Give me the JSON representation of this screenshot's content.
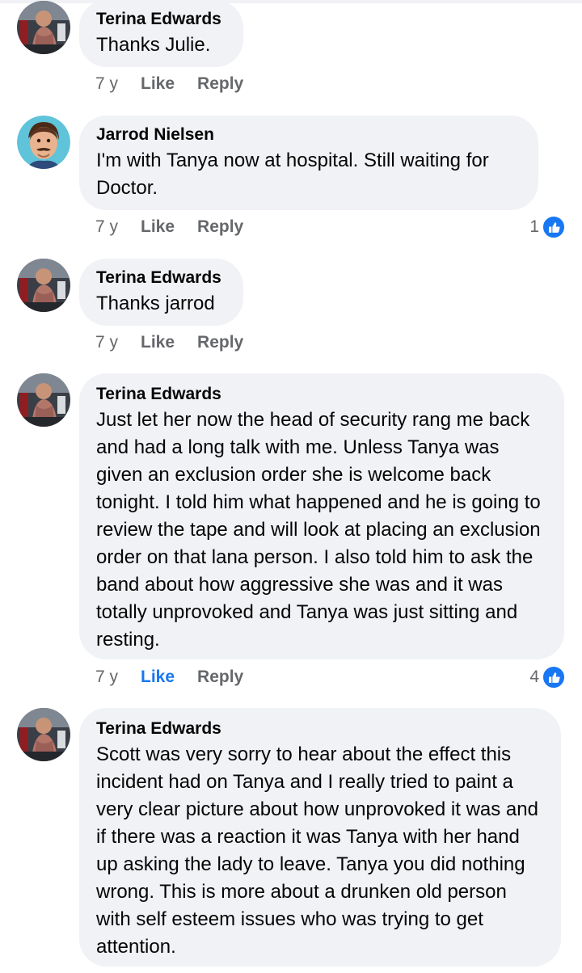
{
  "colors": {
    "bubble": "#f0f2f5",
    "meta_text": "#65676b",
    "like_active": "#1877f2",
    "like_badge": "#1877f2"
  },
  "comments": [
    {
      "author": "Terina Edwards",
      "text": "Thanks Julie.",
      "time": "7 y",
      "like": "Like",
      "reply": "Reply",
      "avatar_icon": "terina-avatar"
    },
    {
      "author": "Jarrod Nielsen",
      "text": "I'm with Tanya now at hospital. Still waiting for Doctor.",
      "time": "7 y",
      "like": "Like",
      "reply": "Reply",
      "reaction_count": "1",
      "reaction_icon": "thumbs-up-icon",
      "avatar_icon": "jarrod-avatar"
    },
    {
      "author": "Terina Edwards",
      "text": "Thanks jarrod",
      "time": "7 y",
      "like": "Like",
      "reply": "Reply",
      "avatar_icon": "terina-avatar"
    },
    {
      "author": "Terina Edwards",
      "text": "Just let her now the head of security rang me back and had a long talk with me. Unless Tanya was given an exclusion order she is welcome back tonight. I told him what happened and he is going to review the tape and will look at placing an exclusion order on that lana person. I also told him to ask the band about how aggressive she was and it was totally unprovoked and Tanya was just sitting and resting.",
      "time": "7 y",
      "like": "Like",
      "like_active": true,
      "reply": "Reply",
      "reaction_count": "4",
      "reaction_icon": "thumbs-up-icon",
      "avatar_icon": "terina-avatar"
    },
    {
      "author": "Terina Edwards",
      "text": "Scott was very sorry to hear about the effect this incident had on Tanya and I really tried to paint a very clear picture about how unprovoked it was and if there was a reaction it was Tanya with her hand up asking the lady to leave. Tanya you did nothing wrong. This is more about a drunken old person with self esteem issues who was trying to get attention.",
      "time": "",
      "like": "",
      "reply": "",
      "avatar_icon": "terina-avatar"
    }
  ]
}
